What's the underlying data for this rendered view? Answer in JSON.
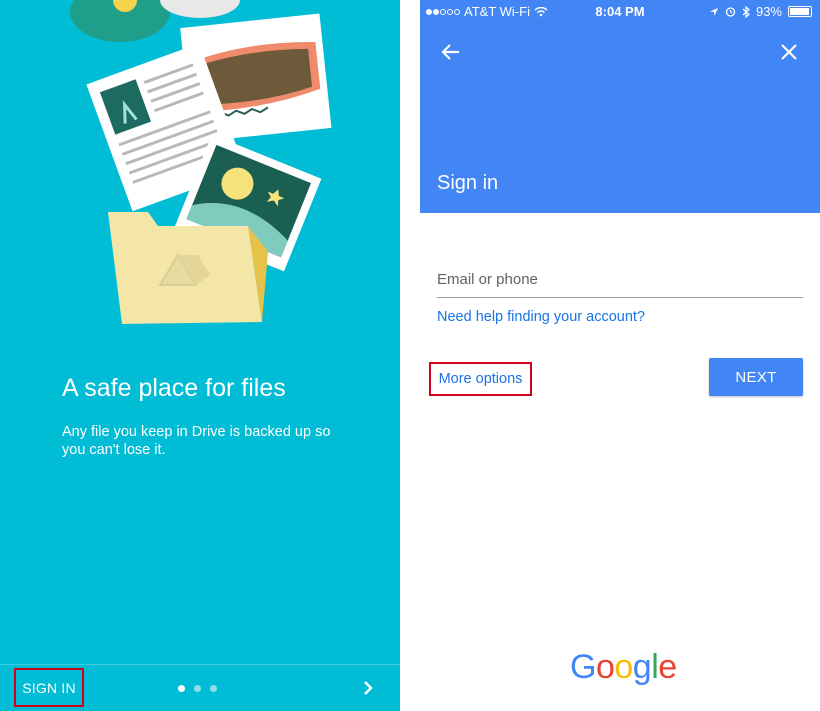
{
  "intro": {
    "headline": "A safe place for files",
    "subtext": "Any file you keep in Drive is backed up so you can't lose it.",
    "sign_in_label": "SIGN IN",
    "page_indicator": {
      "count": 3,
      "active": 1
    }
  },
  "status_bar": {
    "carrier": "AT&T Wi-Fi",
    "time": "8:04 PM",
    "battery": "93%"
  },
  "signin": {
    "title": "Sign in",
    "email_placeholder": "Email or phone",
    "help_link": "Need help finding your account?",
    "more_options": "More options",
    "next_label": "NEXT"
  },
  "footer": {
    "logo_letters": [
      "G",
      "o",
      "o",
      "g",
      "l",
      "e"
    ],
    "logo_colors": [
      "#4285F4",
      "#EA4335",
      "#FBBC05",
      "#4285F4",
      "#34A853",
      "#EA4335"
    ]
  },
  "colors": {
    "intro_bg": "#00BCD4",
    "brand_blue": "#4285F4",
    "link_blue": "#1a73e8",
    "highlight_red": "#d0021b"
  }
}
